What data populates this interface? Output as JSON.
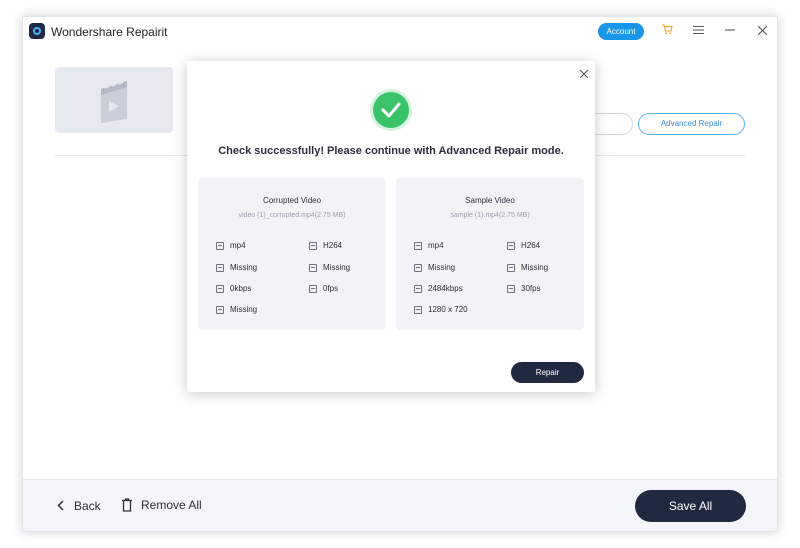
{
  "app": {
    "title": "Wondershare Repairit",
    "account_label": "Account"
  },
  "icons": {
    "cart": "cart-icon",
    "menu": "menu-icon",
    "minimize": "minimize-icon",
    "close": "close-icon",
    "back": "chevron-left-icon",
    "remove": "trash-icon",
    "success": "check-icon",
    "video": "video-file-icon"
  },
  "background": {
    "advanced_repair_label": "Advanced Repair"
  },
  "modal": {
    "message": "Check successfully! Please continue with Advanced Repair mode.",
    "repair_label": "Repair",
    "panels": [
      {
        "title": "Corrupted Video",
        "file": "video (1)_corrupted.mp4(2.75  MB)",
        "specs": [
          "mp4",
          "H264",
          "Missing",
          "Missing",
          "0kbps",
          "0fps",
          "Missing"
        ]
      },
      {
        "title": "Sample Video",
        "file": "sample (1).mp4(2.75  MB)",
        "specs": [
          "mp4",
          "H264",
          "Missing",
          "Missing",
          "2484kbps",
          "30fps",
          "1280 x 720"
        ]
      }
    ]
  },
  "footer": {
    "back_label": "Back",
    "remove_all_label": "Remove All",
    "save_all_label": "Save All"
  },
  "colors": {
    "accent": "#1a96e8",
    "primary_dark": "#20293f",
    "success": "#3bc36a"
  }
}
